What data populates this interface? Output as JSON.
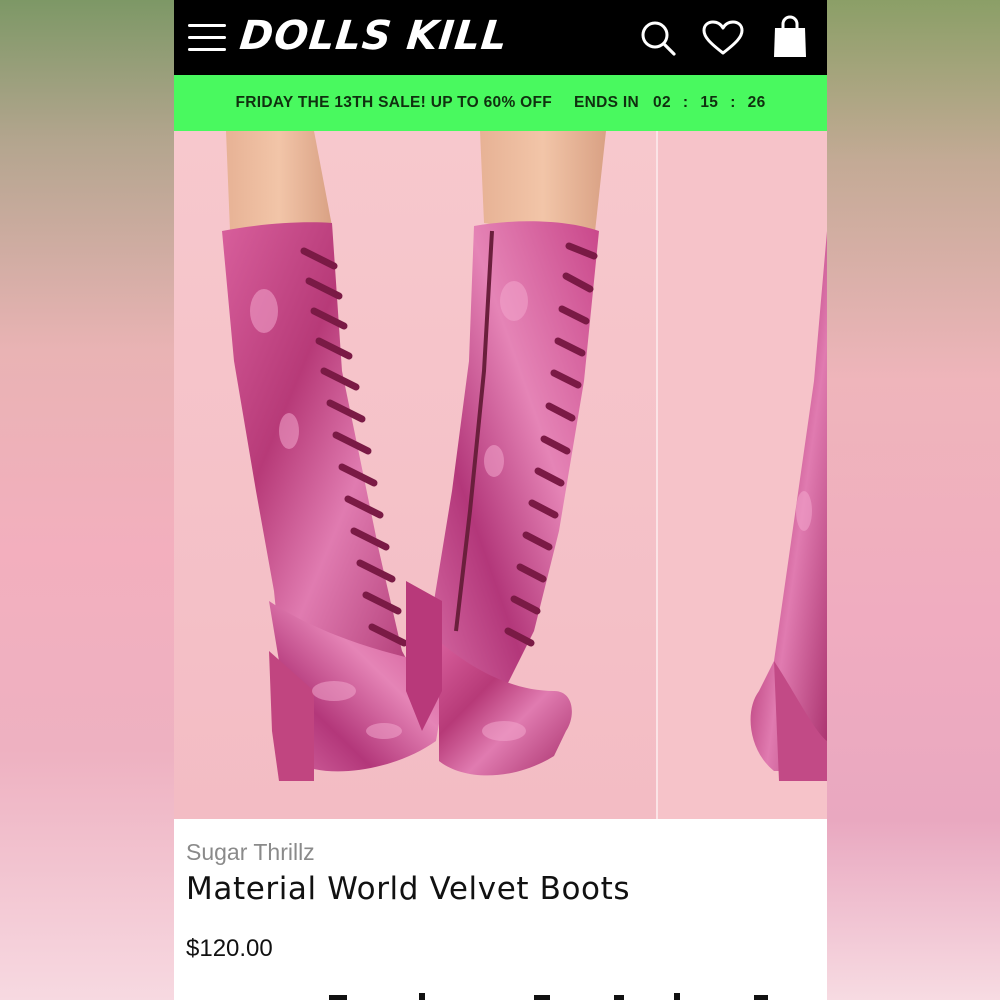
{
  "header": {
    "brand_logo": "DOLLS KILL",
    "icons": [
      "menu-icon",
      "search-icon",
      "heart-icon",
      "bag-icon"
    ]
  },
  "sale_banner": {
    "text": "FRIDAY THE 13TH SALE! UP TO 60% OFF",
    "ends_label": "ENDS IN",
    "countdown": {
      "hours": "02",
      "minutes": "15",
      "seconds": "26",
      "separator": ":"
    },
    "background": "#49f95f"
  },
  "product": {
    "brand": "Sugar Thrillz",
    "name": "Material World Velvet Boots",
    "price": "$120.00",
    "image_subject": "pink crushed velvet lace-up knee-high platform boots"
  },
  "colors": {
    "header_bg": "#000000",
    "sale_green": "#49f95f",
    "boot_pink": "#c24a86",
    "photo_bg": "#f5c6cc"
  }
}
